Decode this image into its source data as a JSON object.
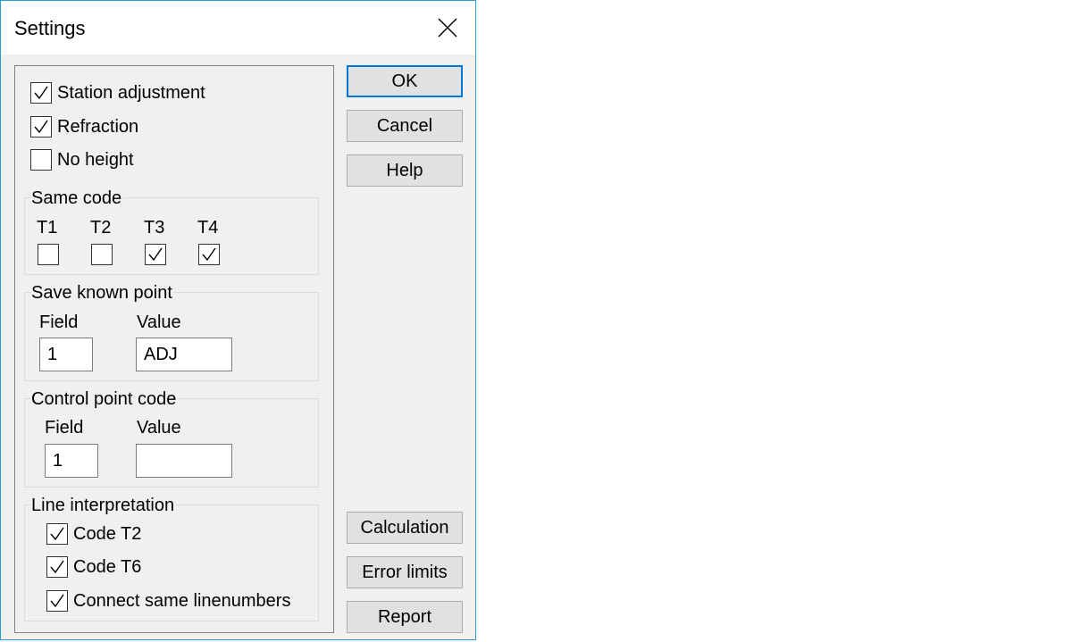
{
  "window": {
    "title": "Settings"
  },
  "options": [
    {
      "label": "Station adjustment",
      "checked": true
    },
    {
      "label": "Refraction",
      "checked": true
    },
    {
      "label": "No height",
      "checked": false
    }
  ],
  "same_code": {
    "title": "Same code",
    "items": [
      {
        "label": "T1",
        "checked": false
      },
      {
        "label": "T2",
        "checked": false
      },
      {
        "label": "T3",
        "checked": true
      },
      {
        "label": "T4",
        "checked": true
      }
    ]
  },
  "save_known_point": {
    "title": "Save known point",
    "field_label": "Field",
    "value_label": "Value",
    "field_value": "1",
    "value_value": "ADJ"
  },
  "control_point_code": {
    "title": "Control point code",
    "field_label": "Field",
    "value_label": "Value",
    "field_value": "1",
    "value_value": ""
  },
  "line_interpretation": {
    "title": "Line interpretation",
    "items": [
      {
        "label": "Code T2",
        "checked": true
      },
      {
        "label": "Code T6",
        "checked": true
      },
      {
        "label": "Connect same linenumbers",
        "checked": true
      }
    ]
  },
  "buttons": {
    "ok": "OK",
    "cancel": "Cancel",
    "help": "Help",
    "calculation": "Calculation",
    "error_limits": "Error limits",
    "report": "Report"
  },
  "colors": {
    "accent": "#0078d7",
    "window_border": "#2b9bd6",
    "dialog_bg": "#f0f0f0"
  }
}
